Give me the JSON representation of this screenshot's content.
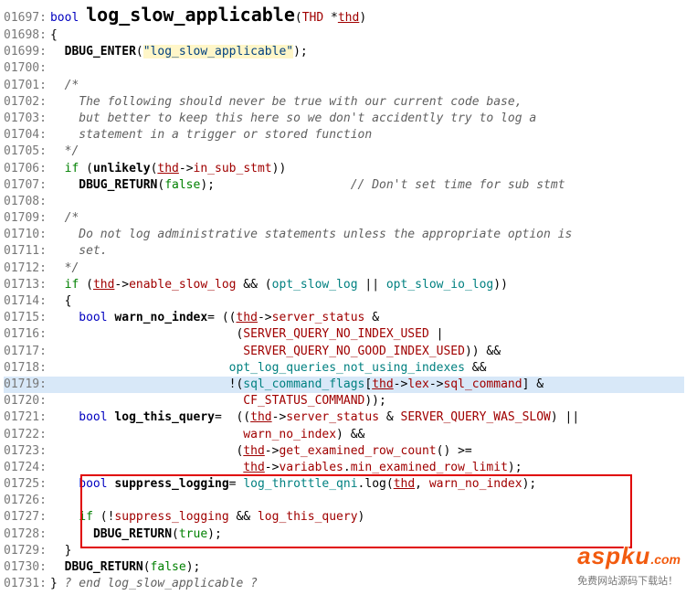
{
  "lines": [
    {
      "n": "01697",
      "parts": [
        {
          "t": "kw-blue",
          "v": "bool"
        },
        {
          "t": "",
          "v": " "
        },
        {
          "t": "func-big",
          "v": "log_slow_applicable"
        },
        {
          "t": "",
          "v": "("
        },
        {
          "t": "ident-red",
          "v": "THD"
        },
        {
          "t": "",
          "v": " *"
        },
        {
          "t": "ident-red-u",
          "v": "thd"
        },
        {
          "t": "",
          "v": ")"
        }
      ]
    },
    {
      "n": "01698",
      "parts": [
        {
          "t": "",
          "v": "{"
        }
      ]
    },
    {
      "n": "01699",
      "parts": [
        {
          "t": "",
          "v": "  "
        },
        {
          "t": "func-bold",
          "v": "DBUG_ENTER"
        },
        {
          "t": "",
          "v": "("
        },
        {
          "t": "str str-bg",
          "v": "\"log_slow_applicable\""
        },
        {
          "t": "",
          "v": ");"
        }
      ]
    },
    {
      "n": "01700",
      "parts": []
    },
    {
      "n": "01701",
      "parts": [
        {
          "t": "comment",
          "v": "  /*"
        }
      ]
    },
    {
      "n": "01702",
      "parts": [
        {
          "t": "comment",
          "v": "    The following should never be true with our current code base,"
        }
      ]
    },
    {
      "n": "01703",
      "parts": [
        {
          "t": "comment",
          "v": "    but better to keep this here so we don't accidently try to log a"
        }
      ]
    },
    {
      "n": "01704",
      "parts": [
        {
          "t": "comment",
          "v": "    statement in a trigger or stored function"
        }
      ]
    },
    {
      "n": "01705",
      "parts": [
        {
          "t": "comment",
          "v": "  */"
        }
      ]
    },
    {
      "n": "01706",
      "parts": [
        {
          "t": "",
          "v": "  "
        },
        {
          "t": "kw-green",
          "v": "if"
        },
        {
          "t": "",
          "v": " ("
        },
        {
          "t": "func-bold",
          "v": "unlikely"
        },
        {
          "t": "",
          "v": "("
        },
        {
          "t": "ident-red-u",
          "v": "thd"
        },
        {
          "t": "",
          "v": "->"
        },
        {
          "t": "ident-red",
          "v": "in_sub_stmt"
        },
        {
          "t": "",
          "v": "))"
        }
      ]
    },
    {
      "n": "01707",
      "parts": [
        {
          "t": "",
          "v": "    "
        },
        {
          "t": "func-bold",
          "v": "DBUG_RETURN"
        },
        {
          "t": "",
          "v": "("
        },
        {
          "t": "kw-green",
          "v": "false"
        },
        {
          "t": "",
          "v": ");                   "
        },
        {
          "t": "comment",
          "v": "// Don't set time for sub stmt"
        }
      ]
    },
    {
      "n": "01708",
      "parts": []
    },
    {
      "n": "01709",
      "parts": [
        {
          "t": "comment",
          "v": "  /*"
        }
      ]
    },
    {
      "n": "01710",
      "parts": [
        {
          "t": "comment",
          "v": "    Do not log administrative statements unless the appropriate option is"
        }
      ]
    },
    {
      "n": "01711",
      "parts": [
        {
          "t": "comment",
          "v": "    set."
        }
      ]
    },
    {
      "n": "01712",
      "parts": [
        {
          "t": "comment",
          "v": "  */"
        }
      ]
    },
    {
      "n": "01713",
      "parts": [
        {
          "t": "",
          "v": "  "
        },
        {
          "t": "kw-green",
          "v": "if"
        },
        {
          "t": "",
          "v": " ("
        },
        {
          "t": "ident-red-u",
          "v": "thd"
        },
        {
          "t": "",
          "v": "->"
        },
        {
          "t": "ident-red",
          "v": "enable_slow_log"
        },
        {
          "t": "",
          "v": " && ("
        },
        {
          "t": "type-teal",
          "v": "opt_slow_log"
        },
        {
          "t": "",
          "v": " || "
        },
        {
          "t": "type-teal",
          "v": "opt_slow_io_log"
        },
        {
          "t": "",
          "v": "))"
        }
      ]
    },
    {
      "n": "01714",
      "parts": [
        {
          "t": "",
          "v": "  {"
        }
      ]
    },
    {
      "n": "01715",
      "parts": [
        {
          "t": "",
          "v": "    "
        },
        {
          "t": "kw-blue",
          "v": "bool"
        },
        {
          "t": "",
          "v": " "
        },
        {
          "t": "func-bold",
          "v": "warn_no_index"
        },
        {
          "t": "",
          "v": "= (("
        },
        {
          "t": "ident-red-u",
          "v": "thd"
        },
        {
          "t": "",
          "v": "->"
        },
        {
          "t": "ident-red",
          "v": "server_status"
        },
        {
          "t": "",
          "v": " &"
        }
      ]
    },
    {
      "n": "01716",
      "parts": [
        {
          "t": "",
          "v": "                          ("
        },
        {
          "t": "ident-red",
          "v": "SERVER_QUERY_NO_INDEX_USED"
        },
        {
          "t": "",
          "v": " |"
        }
      ]
    },
    {
      "n": "01717",
      "parts": [
        {
          "t": "",
          "v": "                           "
        },
        {
          "t": "ident-red",
          "v": "SERVER_QUERY_NO_GOOD_INDEX_USED"
        },
        {
          "t": "",
          "v": ")) &&"
        }
      ]
    },
    {
      "n": "01718",
      "parts": [
        {
          "t": "",
          "v": "                         "
        },
        {
          "t": "type-teal",
          "v": "opt_log_queries_not_using_indexes"
        },
        {
          "t": "",
          "v": " &&"
        }
      ]
    },
    {
      "n": "01719",
      "hl": true,
      "parts": [
        {
          "t": "",
          "v": "                         !("
        },
        {
          "t": "type-teal",
          "v": "sql_command_flags"
        },
        {
          "t": "",
          "v": "["
        },
        {
          "t": "ident-red-u",
          "v": "thd"
        },
        {
          "t": "",
          "v": "->"
        },
        {
          "t": "ident-red",
          "v": "lex"
        },
        {
          "t": "",
          "v": "->"
        },
        {
          "t": "ident-red",
          "v": "sql_command"
        },
        {
          "t": "",
          "v": "] &"
        }
      ]
    },
    {
      "n": "01720",
      "parts": [
        {
          "t": "",
          "v": "                           "
        },
        {
          "t": "ident-red",
          "v": "CF_STATUS_COMMAND"
        },
        {
          "t": "",
          "v": "));"
        }
      ]
    },
    {
      "n": "01721",
      "parts": [
        {
          "t": "",
          "v": "    "
        },
        {
          "t": "kw-blue",
          "v": "bool"
        },
        {
          "t": "",
          "v": " "
        },
        {
          "t": "func-bold",
          "v": "log_this_query"
        },
        {
          "t": "",
          "v": "=  (("
        },
        {
          "t": "ident-red-u",
          "v": "thd"
        },
        {
          "t": "",
          "v": "->"
        },
        {
          "t": "ident-red",
          "v": "server_status"
        },
        {
          "t": "",
          "v": " & "
        },
        {
          "t": "ident-red",
          "v": "SERVER_QUERY_WAS_SLOW"
        },
        {
          "t": "",
          "v": ") ||"
        }
      ]
    },
    {
      "n": "01722",
      "parts": [
        {
          "t": "",
          "v": "                           "
        },
        {
          "t": "ident-red",
          "v": "warn_no_index"
        },
        {
          "t": "",
          "v": ") &&"
        }
      ]
    },
    {
      "n": "01723",
      "parts": [
        {
          "t": "",
          "v": "                          ("
        },
        {
          "t": "ident-red-u",
          "v": "thd"
        },
        {
          "t": "",
          "v": "->"
        },
        {
          "t": "ident-red",
          "v": "get_examined_row_count"
        },
        {
          "t": "",
          "v": "() >="
        }
      ]
    },
    {
      "n": "01724",
      "parts": [
        {
          "t": "",
          "v": "                           "
        },
        {
          "t": "ident-red-u",
          "v": "thd"
        },
        {
          "t": "",
          "v": "->"
        },
        {
          "t": "ident-red",
          "v": "variables"
        },
        {
          "t": "",
          "v": "."
        },
        {
          "t": "ident-red",
          "v": "min_examined_row_limit"
        },
        {
          "t": "",
          "v": ");"
        }
      ]
    },
    {
      "n": "01725",
      "parts": [
        {
          "t": "",
          "v": "    "
        },
        {
          "t": "kw-blue",
          "v": "bool"
        },
        {
          "t": "",
          "v": " "
        },
        {
          "t": "func-bold",
          "v": "suppress_logging"
        },
        {
          "t": "",
          "v": "= "
        },
        {
          "t": "type-teal",
          "v": "log_throttle_qni"
        },
        {
          "t": "",
          "v": ".log("
        },
        {
          "t": "ident-red-u",
          "v": "thd"
        },
        {
          "t": "",
          "v": ", "
        },
        {
          "t": "ident-red",
          "v": "warn_no_index"
        },
        {
          "t": "",
          "v": ");"
        }
      ]
    },
    {
      "n": "01726",
      "parts": []
    },
    {
      "n": "01727",
      "parts": [
        {
          "t": "",
          "v": "    "
        },
        {
          "t": "kw-green",
          "v": "if"
        },
        {
          "t": "",
          "v": " (!"
        },
        {
          "t": "ident-red",
          "v": "suppress_logging"
        },
        {
          "t": "",
          "v": " && "
        },
        {
          "t": "ident-red",
          "v": "log_this_query"
        },
        {
          "t": "",
          "v": ")"
        }
      ]
    },
    {
      "n": "01728",
      "parts": [
        {
          "t": "",
          "v": "      "
        },
        {
          "t": "func-bold",
          "v": "DBUG_RETURN"
        },
        {
          "t": "",
          "v": "("
        },
        {
          "t": "kw-green",
          "v": "true"
        },
        {
          "t": "",
          "v": ");"
        }
      ]
    },
    {
      "n": "01729",
      "parts": [
        {
          "t": "",
          "v": "  }"
        }
      ]
    },
    {
      "n": "01730",
      "parts": [
        {
          "t": "",
          "v": "  "
        },
        {
          "t": "func-bold",
          "v": "DBUG_RETURN"
        },
        {
          "t": "",
          "v": "("
        },
        {
          "t": "kw-green",
          "v": "false"
        },
        {
          "t": "",
          "v": ");"
        }
      ]
    },
    {
      "n": "01731",
      "parts": [
        {
          "t": "",
          "v": "} "
        },
        {
          "t": "comment",
          "v": "? end log_slow_applicable ?"
        }
      ]
    }
  ],
  "red_box": {
    "top_line": "01725",
    "bottom_line": "01728"
  },
  "watermark": {
    "main": "aspku",
    "dot": ".com",
    "sub": "免费网站源码下载站！"
  }
}
